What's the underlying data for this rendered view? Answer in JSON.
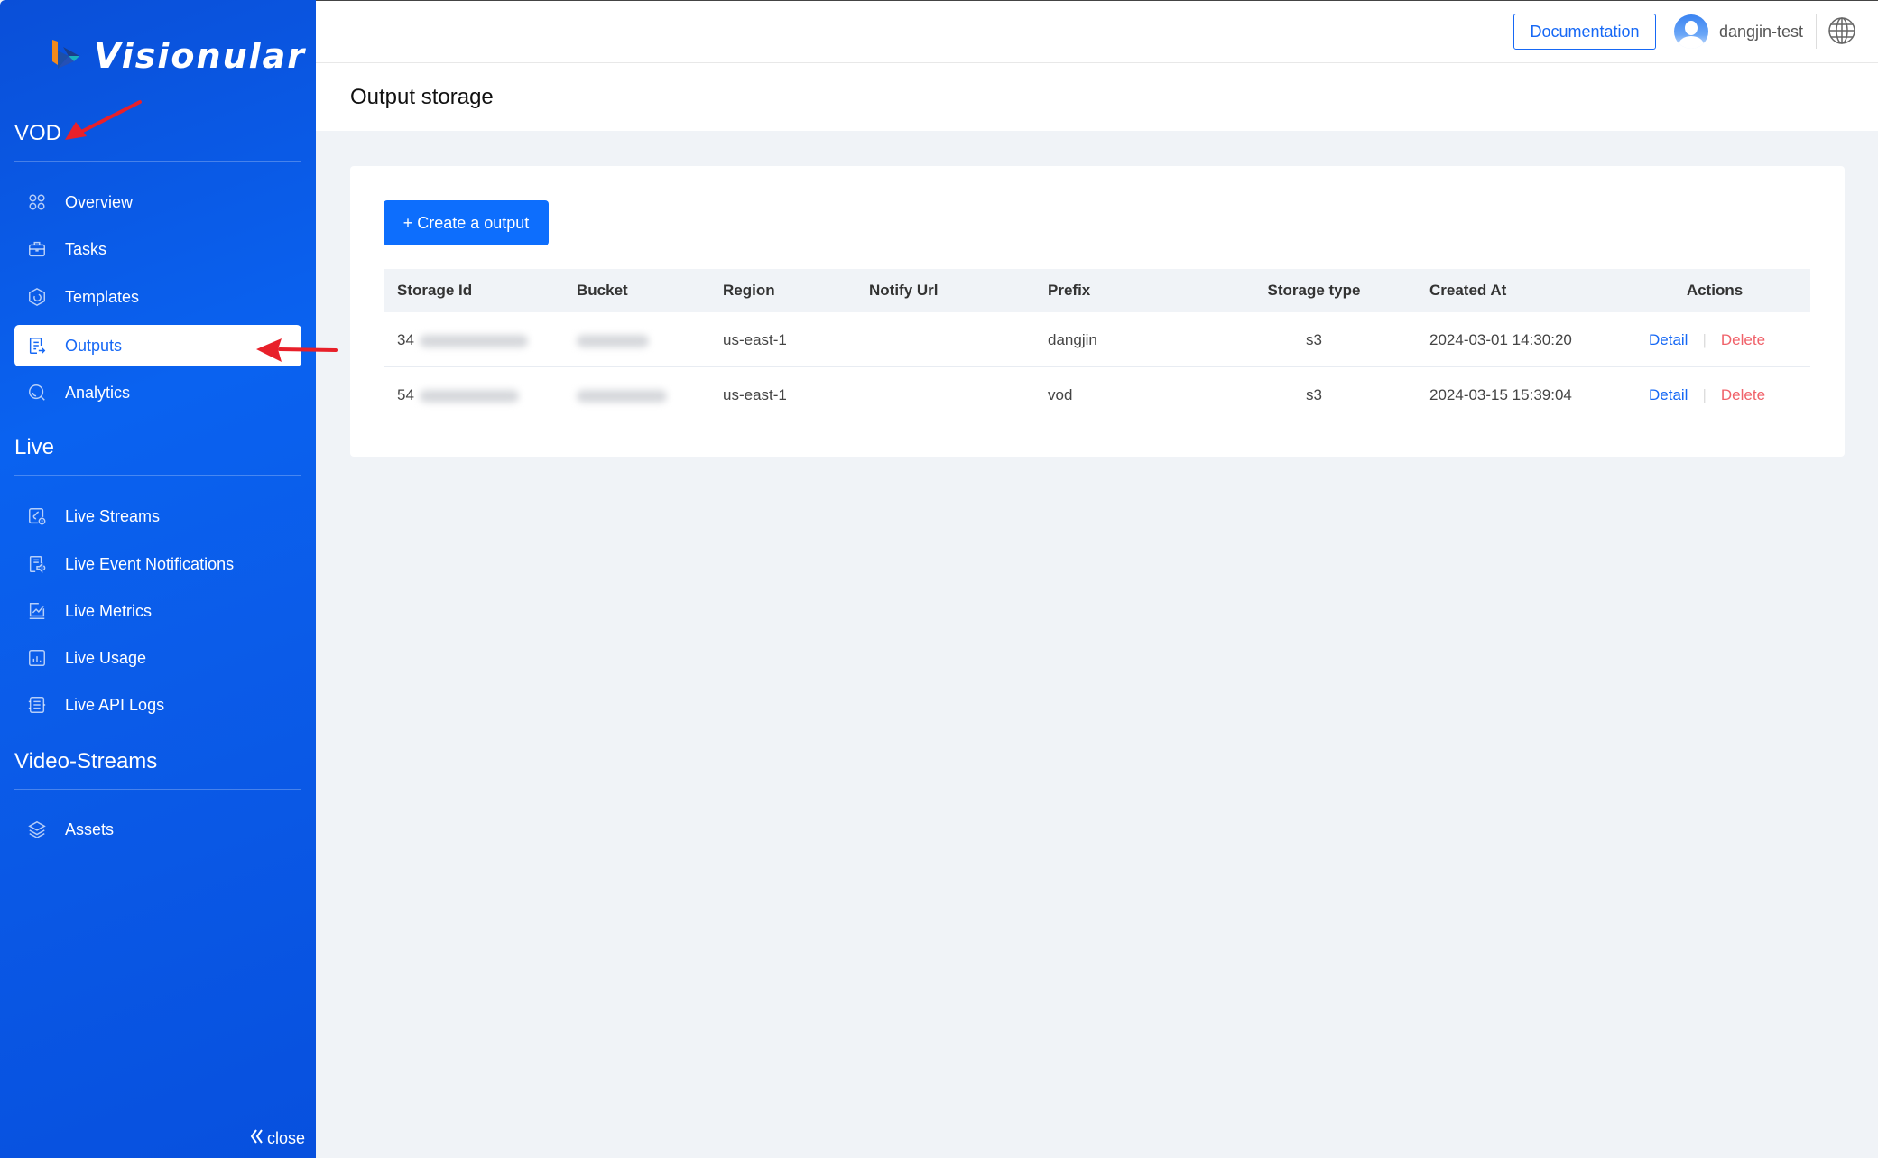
{
  "brand": {
    "name": "Visionular",
    "accent": "#1668f5",
    "sidebar_bg": "#0a5ae8",
    "danger": "#f0626a"
  },
  "sidebar": {
    "sections": [
      {
        "title": "VOD",
        "items": [
          {
            "label": "Overview",
            "icon": "command-icon"
          },
          {
            "label": "Tasks",
            "icon": "briefcase-icon"
          },
          {
            "label": "Templates",
            "icon": "hexagon-icon"
          },
          {
            "label": "Outputs",
            "icon": "document-export-icon",
            "active": true
          },
          {
            "label": "Analytics",
            "icon": "search-analytics-icon"
          }
        ]
      },
      {
        "title": "Live",
        "items": [
          {
            "label": "Live Streams",
            "icon": "stream-clock-icon"
          },
          {
            "label": "Live Event Notifications",
            "icon": "notification-speaker-icon"
          },
          {
            "label": "Live Metrics",
            "icon": "line-chart-icon"
          },
          {
            "label": "Live Usage",
            "icon": "bar-chart-icon"
          },
          {
            "label": "Live API Logs",
            "icon": "log-list-icon"
          }
        ]
      },
      {
        "title": "Video-Streams",
        "items": [
          {
            "label": "Assets",
            "icon": "layers-icon"
          }
        ]
      }
    ],
    "close_label": "close"
  },
  "header": {
    "documentation_label": "Documentation",
    "username": "dangjin-test"
  },
  "page": {
    "title": "Output storage",
    "create_button": "+ Create a output"
  },
  "table": {
    "columns": [
      "Storage Id",
      "Bucket",
      "Region",
      "Notify Url",
      "Prefix",
      "Storage type",
      "Created At",
      "Actions"
    ],
    "rows": [
      {
        "storage_id": "34",
        "bucket": "",
        "region": "us-east-1",
        "notify_url": "",
        "prefix": "dangjin",
        "storage_type": "s3",
        "created_at": "2024-03-01 14:30:20",
        "detail": "Detail",
        "delete": "Delete"
      },
      {
        "storage_id": "54",
        "bucket": "",
        "region": "us-east-1",
        "notify_url": "",
        "prefix": "vod",
        "storage_type": "s3",
        "created_at": "2024-03-15 15:39:04",
        "detail": "Detail",
        "delete": "Delete"
      }
    ]
  }
}
